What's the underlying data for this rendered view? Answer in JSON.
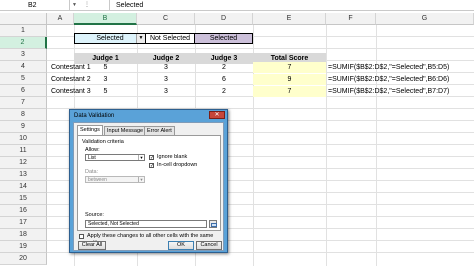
{
  "formula_bar": {
    "name_box": "B2",
    "content": "Selected"
  },
  "columns": [
    "A",
    "B",
    "C",
    "D",
    "E",
    "F",
    "G"
  ],
  "rows": [
    "1",
    "2",
    "3",
    "4",
    "5",
    "6",
    "7",
    "8",
    "9",
    "10",
    "11",
    "12",
    "13",
    "14",
    "15",
    "16",
    "17",
    "18",
    "19",
    "20"
  ],
  "row2": {
    "b": "Selected",
    "c": "Not Selected",
    "d": "Selected"
  },
  "table": {
    "headers": [
      "Judge 1",
      "Judge 2",
      "Judge 3",
      "Total Score"
    ],
    "rows": [
      {
        "name": "Contestant 1",
        "j1": "5",
        "j2": "3",
        "j3": "2",
        "total": "7",
        "formula": "=SUMIF($B$2:D$2,\"=Selected\",B5:D5)"
      },
      {
        "name": "Contestant 2",
        "j1": "3",
        "j2": "3",
        "j3": "6",
        "total": "9",
        "formula": "=SUMIF($B$2:D$2,\"=Selected\",B6:D6)"
      },
      {
        "name": "Contestant 3",
        "j1": "5",
        "j2": "3",
        "j3": "2",
        "total": "7",
        "formula": "=SUMIF($B$2:D$2,\"=Selected\",B7:D7)"
      }
    ]
  },
  "dialog": {
    "title": "Data Validation",
    "close": "✕",
    "tabs": [
      "Settings",
      "Input Message",
      "Error Alert"
    ],
    "criteria_label": "Validation criteria",
    "allow_label": "Allow:",
    "allow_value": "List",
    "data_label": "Data:",
    "data_value": "between",
    "ignore_blank": "Ignore blank",
    "in_cell_dropdown": "In-cell dropdown",
    "source_label": "Source:",
    "source_value": "Selected, Not Selected",
    "apply_all": "Apply these changes to all other cells with the same settings",
    "clear_all": "Clear All",
    "ok": "OK",
    "cancel": "Cancel"
  },
  "colors": {
    "selected_fill": "#ddf3fb",
    "not_selected_fill": "#ffffff",
    "selected_purple_fill": "#ccc0da",
    "header_gray": "#d9d9d9",
    "total_yellow": "#ffffcc",
    "excel_green": "#217346",
    "dialog_blue": "#5aa2d8"
  }
}
